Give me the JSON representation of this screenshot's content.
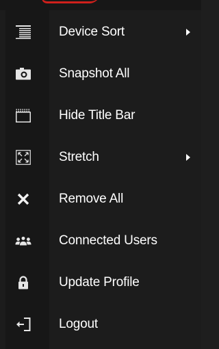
{
  "menu": {
    "items": [
      {
        "label": "Device Sort",
        "icon": "list-lines-icon",
        "has_submenu": true
      },
      {
        "label": "Snapshot All",
        "icon": "camera-icon",
        "has_submenu": false
      },
      {
        "label": "Hide Title Bar",
        "icon": "window-title-bar-icon",
        "has_submenu": false
      },
      {
        "label": "Stretch",
        "icon": "stretch-arrows-icon",
        "has_submenu": true
      },
      {
        "label": "Remove All",
        "icon": "close-x-icon",
        "has_submenu": false
      },
      {
        "label": "Connected Users",
        "icon": "users-group-icon",
        "has_submenu": false
      },
      {
        "label": "Update Profile",
        "icon": "padlock-icon",
        "has_submenu": false
      },
      {
        "label": "Logout",
        "icon": "logout-arrow-icon",
        "has_submenu": false
      }
    ]
  },
  "colors": {
    "background": "#1c1c1c",
    "icon_column": "#171717",
    "text": "#ffffff",
    "accent_red": "#d0201c"
  }
}
